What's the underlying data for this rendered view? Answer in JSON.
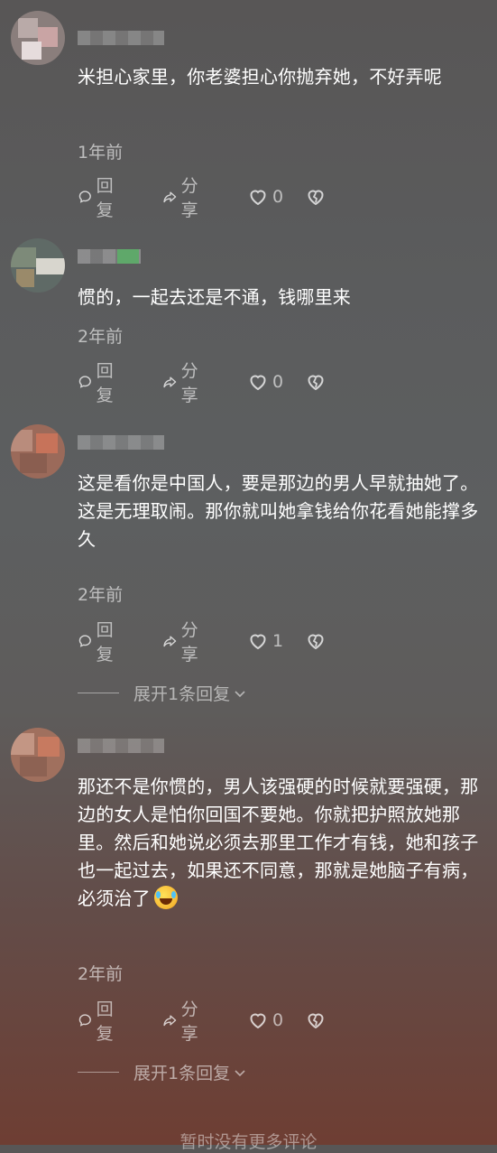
{
  "comments": [
    {
      "username": "用户",
      "text": "米担心家里，你老婆担心你抛弃她，不好弄呢",
      "time": "1年前",
      "reply_label": "回复",
      "share_label": "分享",
      "like_count": "0"
    },
    {
      "username": "用户",
      "text": "惯的，一起去还是不通，钱哪里来",
      "time": "2年前",
      "reply_label": "回复",
      "share_label": "分享",
      "like_count": "0"
    },
    {
      "username": "用户",
      "text": "这是看你是中国人，要是那边的男人早就抽她了。这是无理取闹。那你就叫她拿钱给你花看她能撑多久",
      "time": "2年前",
      "reply_label": "回复",
      "share_label": "分享",
      "like_count": "1",
      "expand_label": "展开1条回复"
    },
    {
      "username": "用户",
      "text": "那还不是你惯的，男人该强硬的时候就要强硬，那边的女人是怕你回国不要她。你就把护照放她那里。然后和她说必须去那里工作才有钱，她和孩子也一起过去，如果还不同意，那就是她脑子有病，必须治了",
      "emoji": "rolling-on-floor-laughing-emoji",
      "time": "2年前",
      "reply_label": "回复",
      "share_label": "分享",
      "like_count": "0",
      "expand_label": "展开1条回复"
    }
  ],
  "footer_text": "暂时没有更多评论",
  "icons": {
    "reply": "comment-bubble-icon",
    "share": "share-arrow-icon",
    "like": "heart-icon",
    "dislike": "broken-heart-icon",
    "expand": "chevron-down-icon"
  }
}
